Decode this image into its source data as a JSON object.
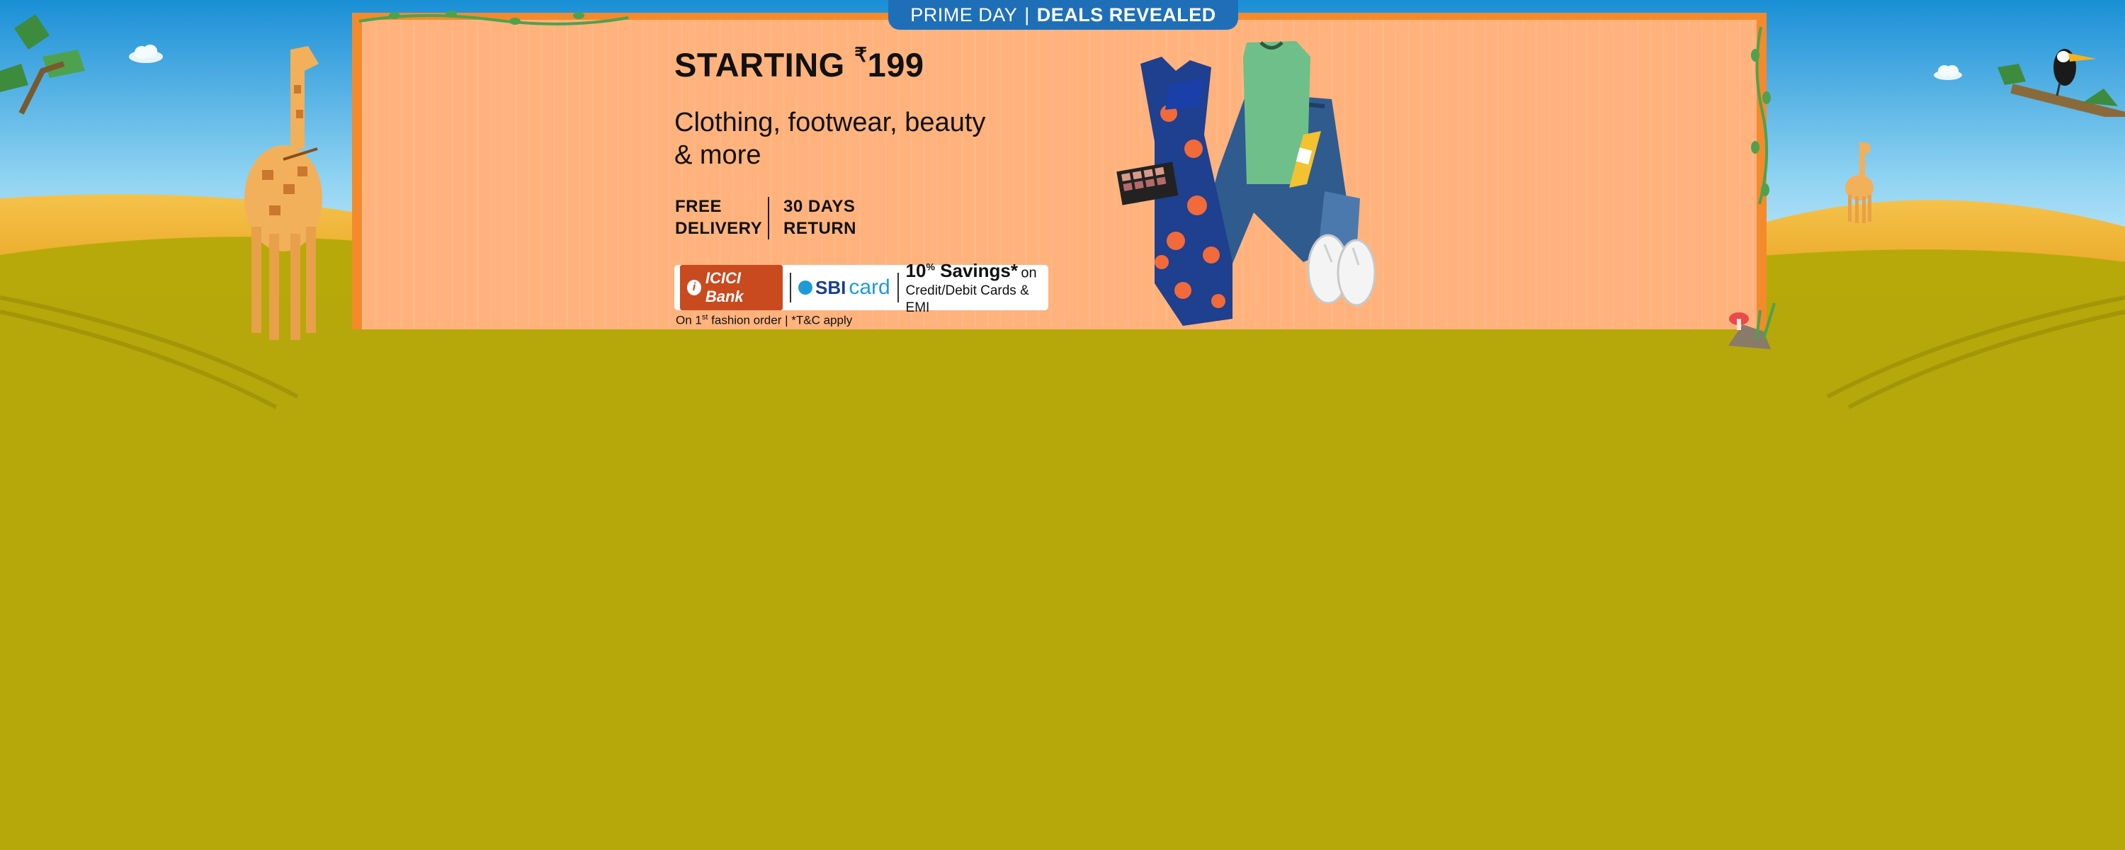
{
  "banner": {
    "ribbon_left": "PRIME DAY",
    "ribbon_sep": "|",
    "ribbon_right": "DEALS REVEALED",
    "headline_prefix": "STARTING",
    "currency": "₹",
    "price": "199",
    "subline_1": "Clothing, footwear, beauty",
    "subline_2": "& more",
    "features": [
      {
        "line1": "FREE",
        "line2": "DELIVERY"
      },
      {
        "line1": "30 DAYS",
        "line2": "RETURN"
      }
    ],
    "offer": {
      "bank1": "ICICI Bank",
      "bank2_a": "SBI",
      "bank2_b": "card",
      "savings_pct": "10",
      "savings_sup": "%",
      "savings_word": "Savings*",
      "savings_on": "on",
      "savings_detail": "Credit/Debit Cards & EMI"
    },
    "footnote_a": "On 1",
    "footnote_sup": "st",
    "footnote_b": " fashion order | *T&C apply"
  },
  "colors": {
    "sky_top": "#1a8fd6",
    "grass": "#b8a90a",
    "board": "#ffb27c",
    "board_frame": "#f48a2c",
    "ribbon": "#1f6fb8"
  },
  "icons": [
    "giraffe-icon",
    "toucan-icon",
    "cloud-icon",
    "mushroom-icon",
    "tree-icon"
  ]
}
